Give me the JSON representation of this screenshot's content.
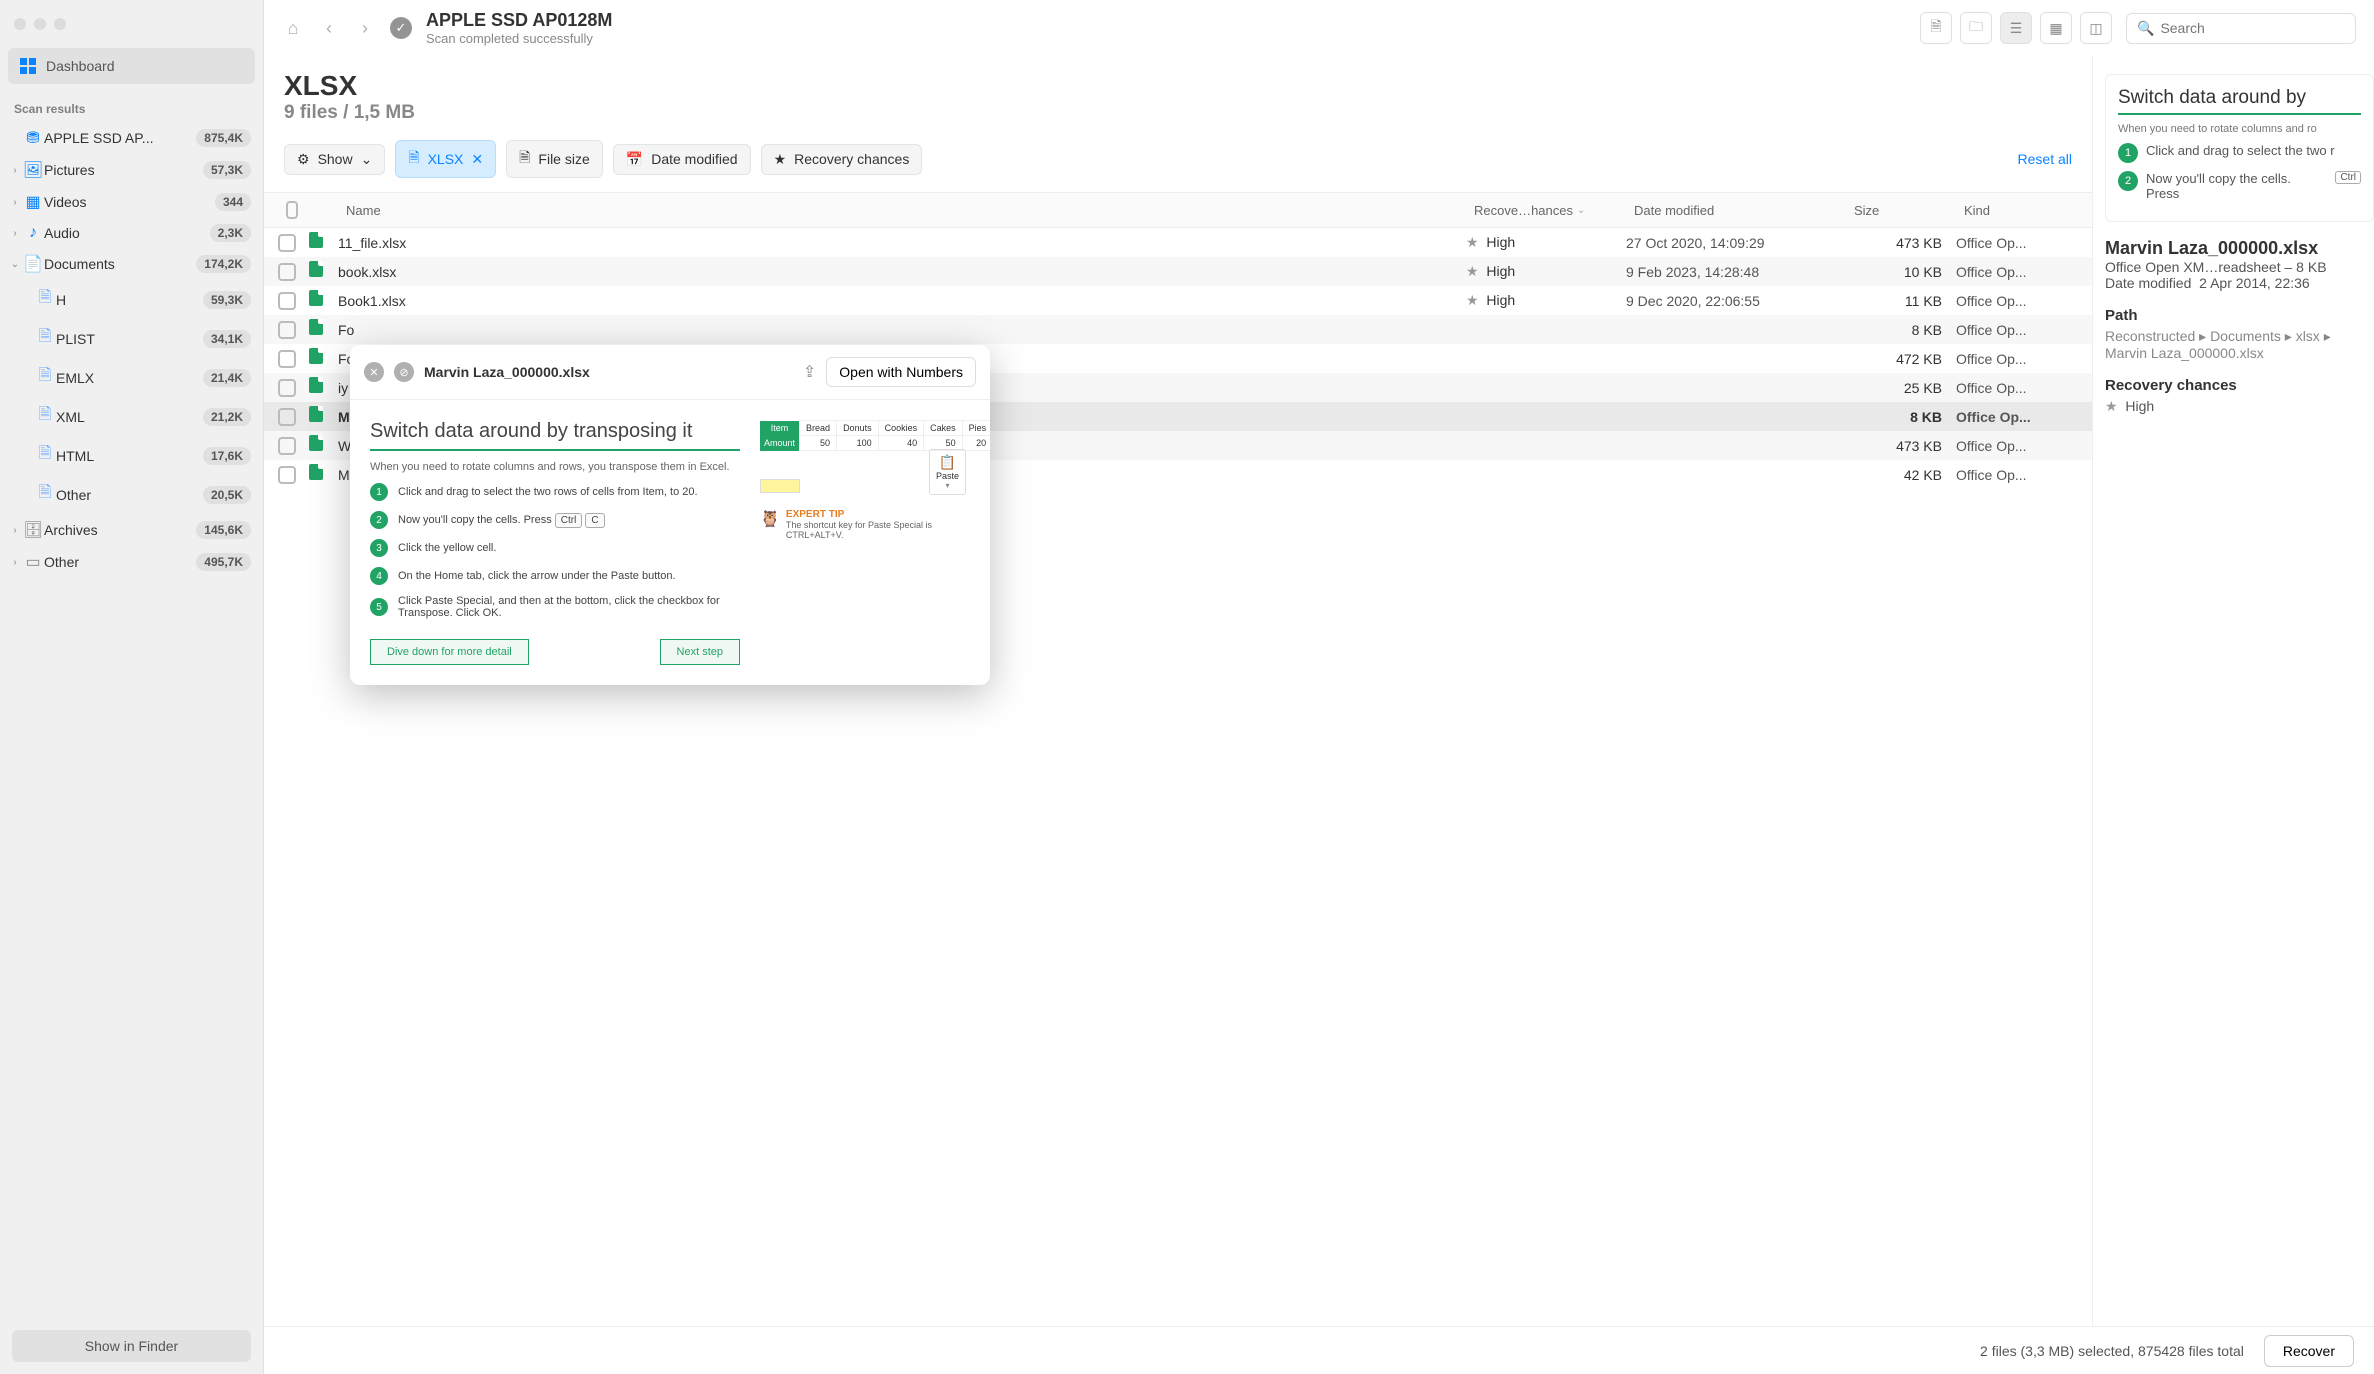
{
  "header": {
    "title": "APPLE SSD AP0128M",
    "subtitle": "Scan completed successfully",
    "search_placeholder": "Search"
  },
  "sidebar": {
    "dashboard": "Dashboard",
    "section_title": "Scan results",
    "show_in_finder": "Show in Finder",
    "items": [
      {
        "label": "APPLE SSD AP...",
        "badge": "875,4K",
        "icon": "drive",
        "caret": false
      },
      {
        "label": "Pictures",
        "badge": "57,3K",
        "icon": "image",
        "caret": true
      },
      {
        "label": "Videos",
        "badge": "344",
        "icon": "video",
        "caret": true
      },
      {
        "label": "Audio",
        "badge": "2,3K",
        "icon": "audio",
        "caret": true
      },
      {
        "label": "Documents",
        "badge": "174,2K",
        "icon": "doc",
        "caret": true,
        "open": true
      },
      {
        "label": "Archives",
        "badge": "145,6K",
        "icon": "archive",
        "caret": true
      },
      {
        "label": "Other",
        "badge": "495,7K",
        "icon": "other",
        "caret": true
      }
    ],
    "doc_children": [
      {
        "label": "H",
        "badge": "59,3K"
      },
      {
        "label": "PLIST",
        "badge": "34,1K"
      },
      {
        "label": "EMLX",
        "badge": "21,4K"
      },
      {
        "label": "XML",
        "badge": "21,2K"
      },
      {
        "label": "HTML",
        "badge": "17,6K"
      },
      {
        "label": "Other",
        "badge": "20,5K"
      }
    ]
  },
  "section": {
    "title": "XLSX",
    "meta": "9 files / 1,5 MB"
  },
  "filters": {
    "show": "Show",
    "active_tag": "XLSX",
    "size": "File size",
    "date": "Date modified",
    "chances": "Recovery chances",
    "reset": "Reset all"
  },
  "columns": {
    "name": "Name",
    "rec": "Recove…hances",
    "date": "Date modified",
    "size": "Size",
    "kind": "Kind"
  },
  "rows": [
    {
      "name": "11_file.xlsx",
      "rec": "High",
      "date": "27 Oct 2020, 14:09:29",
      "size": "473 KB",
      "kind": "Office Op..."
    },
    {
      "name": "book.xlsx",
      "rec": "High",
      "date": "9 Feb 2023, 14:28:48",
      "size": "10 KB",
      "kind": "Office Op..."
    },
    {
      "name": "Book1.xlsx",
      "rec": "High",
      "date": "9 Dec 2020, 22:06:55",
      "size": "11 KB",
      "kind": "Office Op..."
    },
    {
      "name": "Fo",
      "rec": "",
      "date": "",
      "size": "8 KB",
      "kind": "Office Op..."
    },
    {
      "name": "Fo",
      "rec": "",
      "date": "",
      "size": "472 KB",
      "kind": "Office Op..."
    },
    {
      "name": "iy",
      "rec": "",
      "date": "",
      "size": "25 KB",
      "kind": "Office Op..."
    },
    {
      "name": "M",
      "rec": "",
      "date": "",
      "size": "8 KB",
      "kind": "Office Op...",
      "selected": true
    },
    {
      "name": "W",
      "rec": "",
      "date": "",
      "size": "473 KB",
      "kind": "Office Op..."
    },
    {
      "name": "M",
      "rec": "",
      "date": "",
      "size": "42 KB",
      "kind": "Office Op..."
    }
  ],
  "popover": {
    "title": "Marvin Laza_000000.xlsx",
    "open_with": "Open with Numbers",
    "doc_title": "Switch data around by transposing it",
    "intro": "When you need to rotate columns and rows, you transpose them in Excel.",
    "steps": [
      "Click and drag to select the two rows of cells from Item, to 20.",
      "Now you'll copy the cells. Press",
      "Click the yellow cell.",
      "On the Home tab, click the arrow under the Paste button.",
      "Click Paste Special, and then at the bottom, click the checkbox for Transpose. Click OK."
    ],
    "kbd1": "Ctrl",
    "kbd2": "C",
    "btn1": "Dive down for more detail",
    "btn2": "Next step",
    "paste_label": "Paste",
    "expert_title": "EXPERT TIP",
    "expert_body": "The shortcut key for Paste Special is CTRL+ALT+V.",
    "sheet": {
      "headers": [
        "Item",
        "Bread",
        "Donuts",
        "Cookies",
        "Cakes",
        "Pies"
      ],
      "row_label": "Amount",
      "values": [
        "50",
        "100",
        "40",
        "50",
        "20"
      ]
    }
  },
  "preview": {
    "doc_title": "Switch data around by",
    "intro": "When you need to rotate columns and ro",
    "step1": "Click and drag to select the two r",
    "step2": "Now you'll copy the cells. Press",
    "name": "Marvin Laza_000000.xlsx",
    "kind_size": "Office Open XM…readsheet – 8 KB",
    "modified_label": "Date modified",
    "modified_value": "2 Apr 2014, 22:36",
    "path_label": "Path",
    "path_value": "Reconstructed ▸ Documents ▸ xlsx ▸ Marvin Laza_000000.xlsx",
    "chances_label": "Recovery chances",
    "chances_value": "High"
  },
  "chart_data": {
    "type": "table",
    "title": "Switch data around by transposing it",
    "headers": [
      "Item",
      "Bread",
      "Donuts",
      "Cookies",
      "Cakes",
      "Pies"
    ],
    "rows": [
      {
        "label": "Amount",
        "values": [
          50,
          100,
          40,
          50,
          20
        ]
      }
    ]
  },
  "status": {
    "summary": "2 files (3,3 MB) selected, 875428 files total",
    "recover": "Recover"
  }
}
